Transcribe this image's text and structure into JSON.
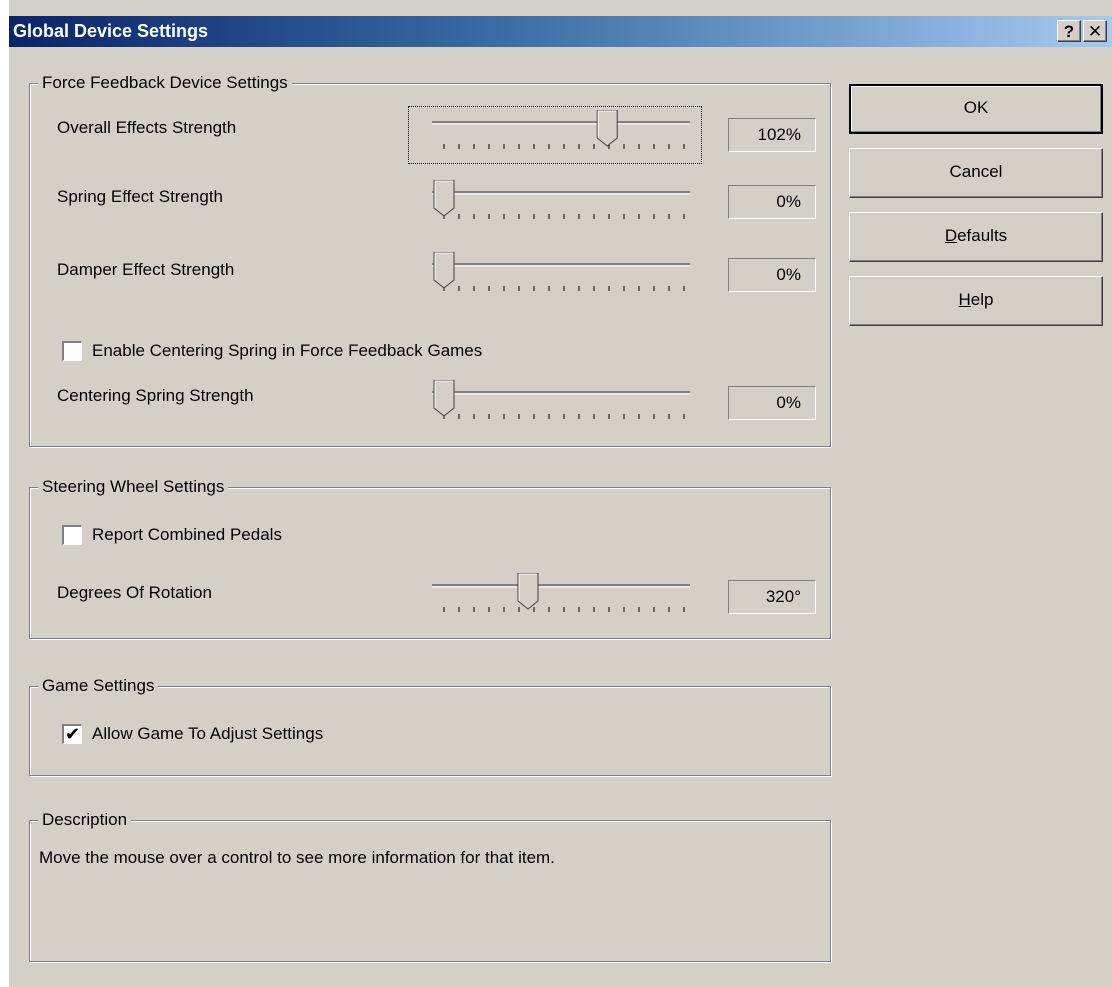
{
  "window": {
    "title": "Global Device Settings",
    "help_glyph": "?",
    "close_glyph": "✕"
  },
  "ff_group": {
    "label": "Force Feedback Device Settings",
    "overall": {
      "label": "Overall Effects Strength",
      "value": "102%",
      "level": 0.68
    },
    "spring": {
      "label": "Spring Effect Strength",
      "value": "0%",
      "level": 0
    },
    "damper": {
      "label": "Damper Effect Strength",
      "value": "0%",
      "level": 0
    },
    "centering_checkbox": {
      "label": "Enable Centering Spring in Force Feedback Games",
      "checked": false
    },
    "centering": {
      "label": "Centering Spring Strength",
      "value": "0%",
      "level": 0
    }
  },
  "wheel_group": {
    "label": "Steering Wheel Settings",
    "pedals_checkbox": {
      "label": "Report Combined Pedals",
      "checked": false
    },
    "rotation": {
      "label": "Degrees Of Rotation",
      "value": "320°",
      "level": 0.35
    }
  },
  "game_group": {
    "label": "Game Settings",
    "adjust_checkbox": {
      "label": "Allow Game To Adjust Settings",
      "checked": true,
      "mark": "✔"
    }
  },
  "desc_group": {
    "label": "Description",
    "text": "Move the mouse over a control to see more information for that item."
  },
  "buttons": {
    "ok": "OK",
    "cancel": "Cancel",
    "defaults_first": "D",
    "defaults_rest": "efaults",
    "help_first": "H",
    "help_rest": "elp"
  }
}
